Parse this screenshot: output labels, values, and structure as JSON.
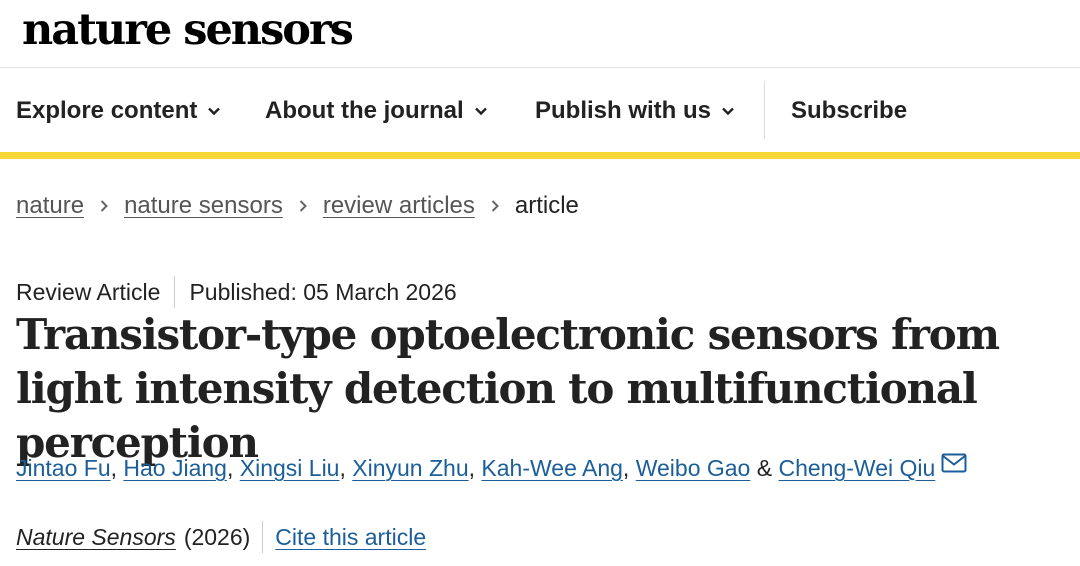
{
  "masthead": {
    "logo_text": "nature sensors"
  },
  "nav": {
    "items": [
      {
        "label": "Explore content",
        "icon": "chevron-down-icon"
      },
      {
        "label": "About the journal",
        "icon": "chevron-down-icon"
      },
      {
        "label": "Publish with us",
        "icon": "chevron-down-icon"
      }
    ],
    "subscribe_label": "Subscribe",
    "accent_color": "#f5d836"
  },
  "breadcrumb": {
    "items": [
      "nature",
      "nature sensors",
      "review articles"
    ],
    "current": "article"
  },
  "article": {
    "type": "Review Article",
    "published": "Published: 05 March 2026",
    "title": "Transistor-type optoelectronic sensors from light intensity detection to multifunctional perception",
    "authors": [
      "Jintao Fu",
      "Hao Jiang",
      "Xingsi Liu",
      "Xinyun Zhu",
      "Kah-Wee Ang",
      "Weibo Gao",
      "Cheng-Wei Qiu"
    ],
    "author_separators": [
      ", ",
      ", ",
      ", ",
      ", ",
      ", ",
      " & "
    ],
    "corresponding_icon": "mail-icon",
    "link_color": "#1b5e99",
    "journal": "Nature Sensors",
    "year": "(2026)",
    "cite_label": "Cite this article"
  }
}
